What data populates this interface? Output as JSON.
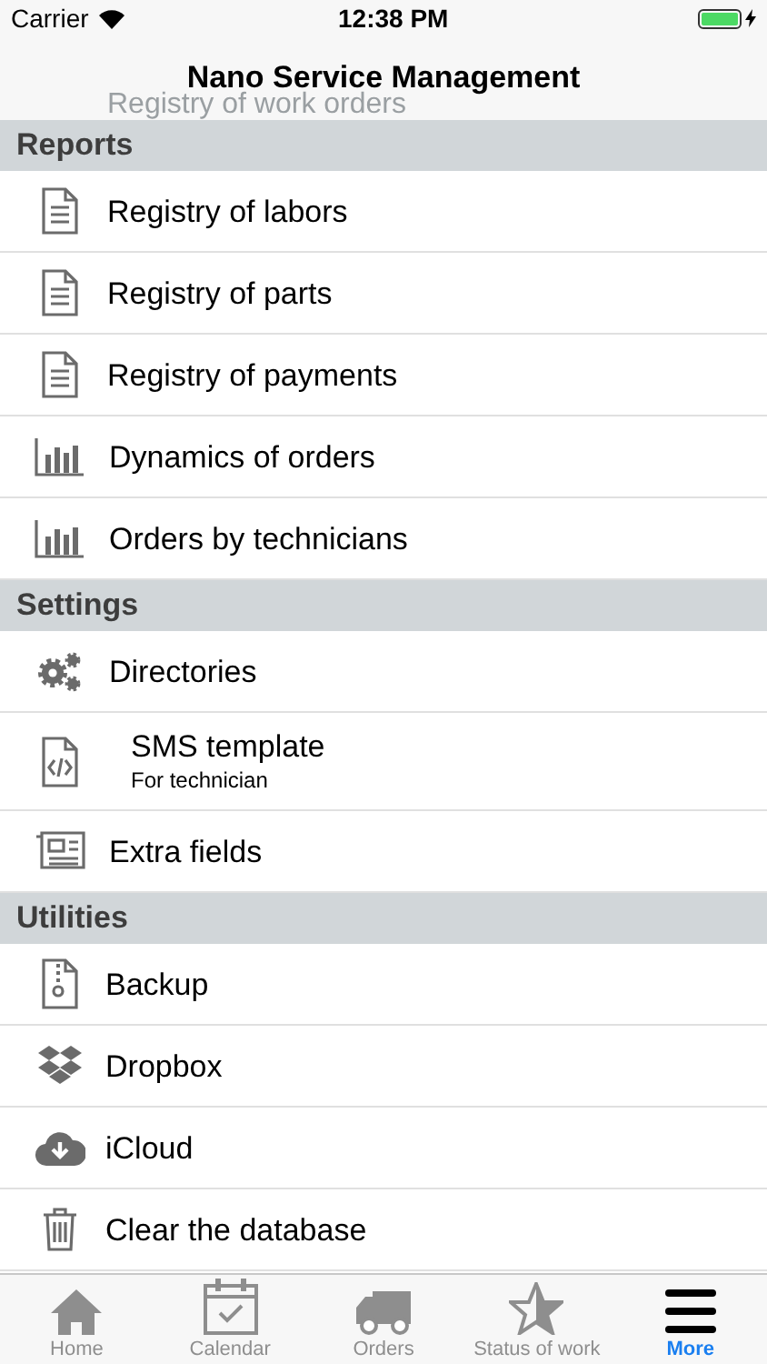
{
  "status_bar": {
    "carrier": "Carrier",
    "time": "12:38 PM"
  },
  "nav_bar": {
    "title": "Nano Service Management"
  },
  "scrolled_row": {
    "label": "Registry of work orders"
  },
  "sections": [
    {
      "title": "Reports",
      "items": [
        {
          "label": "Registry of labors"
        },
        {
          "label": "Registry of parts"
        },
        {
          "label": "Registry of payments"
        },
        {
          "label": "Dynamics of orders"
        },
        {
          "label": "Orders by technicians"
        }
      ]
    },
    {
      "title": "Settings",
      "items": [
        {
          "label": "Directories"
        },
        {
          "label": "SMS template",
          "subtitle": "For technician"
        },
        {
          "label": "Extra fields"
        }
      ]
    },
    {
      "title": "Utilities",
      "items": [
        {
          "label": "Backup"
        },
        {
          "label": "Dropbox"
        },
        {
          "label": "iCloud"
        },
        {
          "label": "Clear the database"
        }
      ]
    }
  ],
  "tab_bar": [
    {
      "label": "Home",
      "selected": false
    },
    {
      "label": "Calendar",
      "selected": false
    },
    {
      "label": "Orders",
      "selected": false
    },
    {
      "label": "Status of work",
      "selected": false
    },
    {
      "label": "More",
      "selected": true
    }
  ]
}
